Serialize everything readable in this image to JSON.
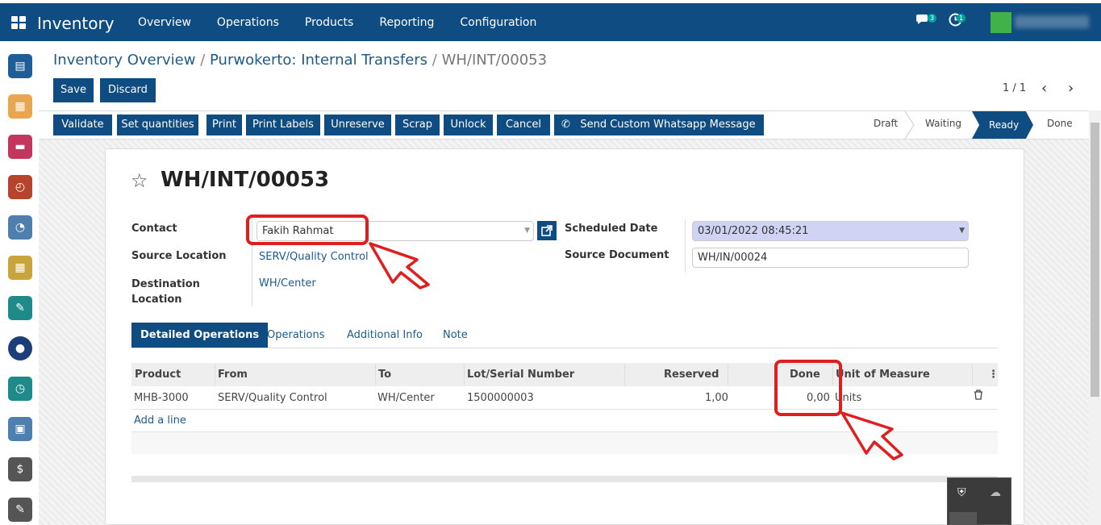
{
  "app": {
    "title": "Inventory",
    "menu": [
      "Overview",
      "Operations",
      "Products",
      "Reporting",
      "Configuration"
    ],
    "messages_count": "3",
    "activities_count": "1",
    "colors": {
      "navbar": "#0f4c81",
      "highlight": "#e01e1e",
      "link": "#1d5a8c"
    }
  },
  "breadcrumb": {
    "part1": "Inventory Overview",
    "sep": "/",
    "part2": "Purwokerto: Internal Transfers",
    "current": "WH/INT/00053"
  },
  "toolbar": {
    "save": "Save",
    "discard": "Discard",
    "pager": "1 / 1"
  },
  "actions": [
    "Validate",
    "Set quantities",
    "Print",
    "Print Labels",
    "Unreserve",
    "Scrap",
    "Unlock",
    "Cancel",
    "Send Custom Whatsapp Message"
  ],
  "stages": {
    "draft": "Draft",
    "waiting": "Waiting",
    "ready": "Ready",
    "done": "Done",
    "current": "Ready"
  },
  "record": {
    "name": "WH/INT/00053",
    "contact_label": "Contact",
    "contact": "Fakih Rahmat",
    "source_location_label": "Source Location",
    "source_location": "SERV/Quality Control",
    "destination_location_label": "Destination Location",
    "destination_location_l1": "Destination",
    "destination_location_l2": "Location",
    "destination_location": "WH/Center",
    "scheduled_date_label": "Scheduled Date",
    "scheduled_date": "03/01/2022 08:45:21",
    "source_document_label": "Source Document",
    "source_document": "WH/IN/00024"
  },
  "tabs": [
    "Detailed Operations",
    "Operations",
    "Additional Info",
    "Note"
  ],
  "table": {
    "headers": [
      "Product",
      "From",
      "To",
      "Lot/Serial Number",
      "Reserved",
      "Done",
      "Unit of Measure"
    ],
    "rows": [
      {
        "product": "MHB-3000",
        "from": "SERV/Quality Control",
        "to": "WH/Center",
        "lot": "1500000003",
        "reserved": "1,00",
        "done": "0,00",
        "uom": "Units"
      }
    ],
    "add_line": "Add a line"
  }
}
